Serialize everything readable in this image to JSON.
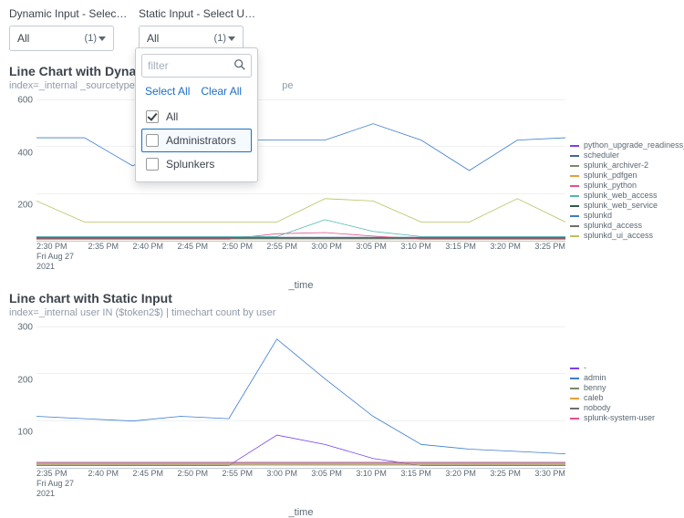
{
  "inputs": {
    "dynamic": {
      "label": "Dynamic Input - Select Sourc...",
      "value": "All",
      "count": "(1)"
    },
    "static": {
      "label": "Static Input - Select User",
      "value": "All",
      "count": "(1)"
    }
  },
  "dropdown": {
    "filter_placeholder": "filter",
    "select_all": "Select All",
    "clear_all": "Clear All",
    "items": [
      {
        "label": "All",
        "checked": true,
        "focused": false
      },
      {
        "label": "Administrators",
        "checked": false,
        "focused": true
      },
      {
        "label": "Splunkers",
        "checked": false,
        "focused": false
      }
    ]
  },
  "panel1": {
    "title": "Line Chart with Dynamic Inpu",
    "subtitle": "index=_internal _sourcetype IN ($t",
    "subtitle_tail": "pe",
    "xlabel": "_time"
  },
  "panel2": {
    "title": "Line chart with Static Input",
    "subtitle": "index=_internal user IN ($token2$) | timechart count by user",
    "xlabel": "_time"
  },
  "chart_data": [
    {
      "type": "line",
      "title": "Line Chart with Dynamic Input",
      "xlabel": "_time",
      "ylabel": "",
      "ylim": [
        0,
        600
      ],
      "categories": [
        "2:30 PM",
        "2:35 PM",
        "2:40 PM",
        "2:45 PM",
        "2:50 PM",
        "2:55 PM",
        "3:00 PM",
        "3:05 PM",
        "3:10 PM",
        "3:15 PM",
        "3:20 PM",
        "3:25 PM"
      ],
      "x_axis_sublabel": "Fri Aug 27 2021",
      "series": [
        {
          "name": "python_upgrade_readiness_app",
          "color": "#7b3ff2",
          "values": [
            10,
            10,
            10,
            10,
            10,
            10,
            10,
            10,
            10,
            10,
            10,
            10
          ]
        },
        {
          "name": "scheduler",
          "color": "#3d679e",
          "values": [
            15,
            15,
            15,
            15,
            15,
            15,
            15,
            15,
            15,
            15,
            15,
            15
          ]
        },
        {
          "name": "splunk_archiver-2",
          "color": "#7a8a68",
          "values": [
            10,
            10,
            10,
            10,
            10,
            10,
            10,
            10,
            10,
            10,
            10,
            10
          ]
        },
        {
          "name": "splunk_pdfgen",
          "color": "#e6a03e",
          "values": [
            5,
            5,
            5,
            5,
            5,
            5,
            5,
            5,
            5,
            5,
            5,
            5
          ]
        },
        {
          "name": "splunk_python",
          "color": "#e44f8b",
          "values": [
            8,
            8,
            8,
            8,
            8,
            30,
            35,
            20,
            8,
            8,
            8,
            8
          ]
        },
        {
          "name": "splunk_web_access",
          "color": "#4fb7b0",
          "values": [
            18,
            18,
            18,
            18,
            18,
            18,
            90,
            40,
            18,
            18,
            18,
            18
          ]
        },
        {
          "name": "splunk_web_service",
          "color": "#2f5b4a",
          "values": [
            12,
            12,
            12,
            12,
            12,
            12,
            12,
            12,
            12,
            12,
            12,
            12
          ]
        },
        {
          "name": "splunkd",
          "color": "#3c7dd1",
          "values": [
            440,
            440,
            320,
            430,
            430,
            430,
            430,
            500,
            430,
            300,
            430,
            440
          ]
        },
        {
          "name": "splunkd_access",
          "color": "#6e6e6e",
          "values": [
            14,
            14,
            14,
            14,
            14,
            14,
            14,
            14,
            14,
            14,
            14,
            14
          ]
        },
        {
          "name": "splunkd_ui_access",
          "color": "#b6c25f",
          "values": [
            170,
            80,
            80,
            80,
            80,
            80,
            180,
            170,
            80,
            80,
            180,
            80
          ]
        }
      ]
    },
    {
      "type": "line",
      "title": "Line chart with Static Input",
      "xlabel": "_time",
      "ylabel": "",
      "ylim": [
        0,
        300
      ],
      "categories": [
        "2:35 PM",
        "2:40 PM",
        "2:45 PM",
        "2:50 PM",
        "2:55 PM",
        "3:00 PM",
        "3:05 PM",
        "3:10 PM",
        "3:15 PM",
        "3:20 PM",
        "3:25 PM",
        "3:30 PM"
      ],
      "x_axis_sublabel": "Fri Aug 27 2021",
      "series": [
        {
          "name": "-",
          "color": "#7b3ff2",
          "values": [
            5,
            5,
            5,
            5,
            5,
            70,
            50,
            20,
            5,
            5,
            5,
            5
          ]
        },
        {
          "name": "admin",
          "color": "#3c7dd1",
          "values": [
            110,
            105,
            100,
            110,
            105,
            275,
            190,
            110,
            50,
            40,
            35,
            30
          ]
        },
        {
          "name": "benny",
          "color": "#7a8a68",
          "values": [
            6,
            6,
            6,
            6,
            6,
            6,
            6,
            6,
            6,
            6,
            6,
            6
          ]
        },
        {
          "name": "caleb",
          "color": "#e6a03e",
          "values": [
            8,
            8,
            8,
            8,
            8,
            8,
            8,
            8,
            8,
            8,
            8,
            8
          ]
        },
        {
          "name": "nobody",
          "color": "#6e6e6e",
          "values": [
            10,
            10,
            10,
            10,
            10,
            10,
            10,
            10,
            10,
            10,
            10,
            10
          ]
        },
        {
          "name": "splunk-system-user",
          "color": "#e44f8b",
          "values": [
            12,
            12,
            12,
            12,
            12,
            12,
            12,
            12,
            12,
            12,
            12,
            12
          ]
        }
      ]
    }
  ]
}
